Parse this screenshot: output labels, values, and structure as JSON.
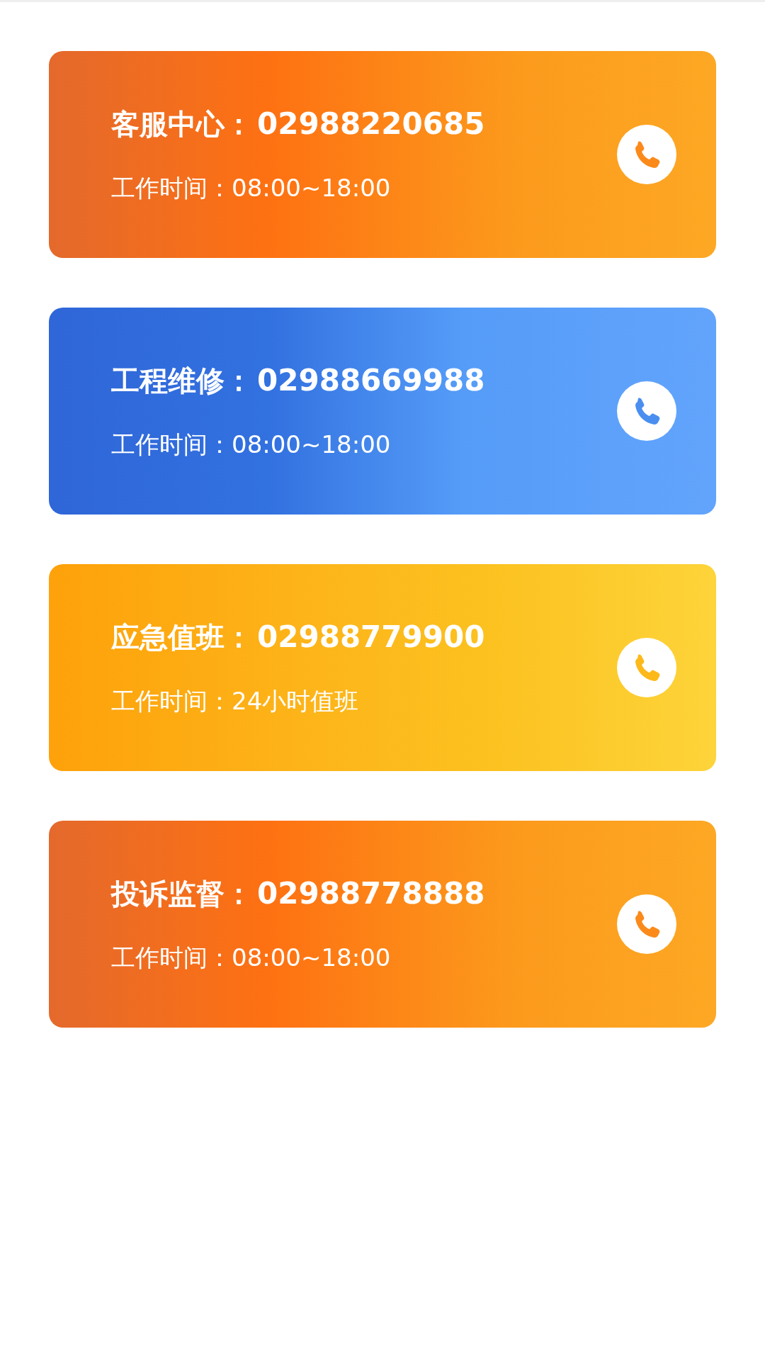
{
  "contacts": [
    {
      "label": "客服中心：",
      "number": "02988220685",
      "hours_label": "工作时间：",
      "hours": "08:00~18:00",
      "kind": "orange"
    },
    {
      "label": "工程维修：",
      "number": "02988669988",
      "hours_label": "工作时间：",
      "hours": "08:00~18:00",
      "kind": "blue"
    },
    {
      "label": "应急值班：",
      "number": "02988779900",
      "hours_label": "工作时间：",
      "hours": "24小时值班",
      "kind": "yellow"
    },
    {
      "label": "投诉监督：",
      "number": "02988778888",
      "hours_label": "工作时间：",
      "hours": "08:00~18:00",
      "kind": "orange"
    }
  ]
}
